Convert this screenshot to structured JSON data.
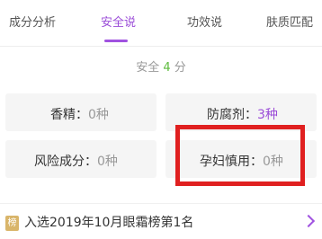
{
  "tabs": [
    {
      "label": "成分分析"
    },
    {
      "label": "安全说"
    },
    {
      "label": "功效说"
    },
    {
      "label": "肤质匹配"
    }
  ],
  "active_tab": "安全说",
  "score": {
    "label": "安全",
    "value": "4",
    "unit": "分"
  },
  "cards": {
    "fragrance": {
      "label": "香精：",
      "value": "0种"
    },
    "preservative": {
      "label": "防腐剂：",
      "value": "3种"
    },
    "risk": {
      "label": "风险成分：",
      "value": "0种"
    },
    "pregnancy": {
      "label": "孕妇慎用：",
      "value": "0种"
    }
  },
  "ranking": {
    "badge": "榜",
    "text": "入选2019年10月眼霜榜第1名"
  },
  "colors": {
    "accent": "#9b4dd8",
    "score": "#5dbb3d",
    "highlight": "#e02020"
  }
}
